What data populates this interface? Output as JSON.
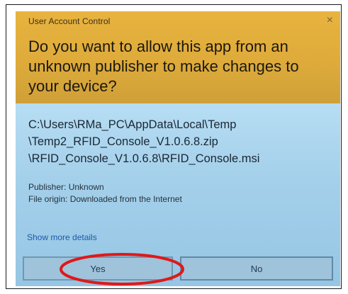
{
  "dialog": {
    "title": "User Account Control",
    "close_glyph": "×",
    "question": "Do you want to allow this app from an unknown publisher to make changes to your device?",
    "path_lines": [
      "C:\\Users\\RMa_PC\\AppData\\Local\\Temp",
      "\\Temp2_RFID_Console_V1.0.6.8.zip",
      "\\RFID_Console_V1.0.6.8\\RFID_Console.msi"
    ],
    "publisher": "Publisher: Unknown",
    "file_origin": "File origin: Downloaded from the Internet",
    "more_details": "Show more details",
    "yes_label": "Yes",
    "no_label": "No"
  },
  "colors": {
    "header": "#e2ae3d",
    "body": "#a7d2ec",
    "annotation": "#e01818"
  },
  "icons": {
    "close": "close-icon"
  }
}
